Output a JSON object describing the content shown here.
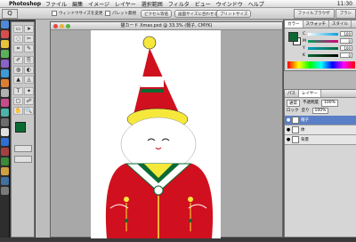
{
  "menubar": {
    "apple": "",
    "app": "Photoshop",
    "items": [
      "ファイル",
      "編集",
      "イメージ",
      "レイヤー",
      "選択範囲",
      "フィルタ",
      "ビュー",
      "ウインドウ",
      "ヘルプ"
    ],
    "clock": "11:30"
  },
  "optionsbar": {
    "tool_icon": "Q",
    "checkbox1": "ウィンドウサイズを変更",
    "checkbox2": "パレット無視",
    "button1": "ピクセル等倍",
    "button2": "画面サイズに合わせる",
    "button3": "プリントサイズ",
    "tab1": "ファイルブラウザ",
    "tab2": "ブラシ"
  },
  "document": {
    "title": "猫カード Xmas.psd @ 33.3% (帽子, CMYK)"
  },
  "colorpanel": {
    "tabs": [
      "カラー",
      "スウォッチ",
      "スタイル"
    ],
    "channels": [
      {
        "label": "C",
        "value": "100"
      },
      {
        "label": "M",
        "value": "0"
      },
      {
        "label": "Y",
        "value": "100"
      },
      {
        "label": "K",
        "value": "0"
      }
    ],
    "fg_color": "#0b6a33"
  },
  "layerspanel": {
    "tabs": [
      "パス",
      "レイヤー"
    ],
    "mode": "通常",
    "opacity_label": "不透明度",
    "opacity": "100%",
    "lock_label": "ロック",
    "fill_label": "塗り",
    "fill": "100%",
    "layers": [
      {
        "name": "帽子",
        "selected": true
      },
      {
        "name": "体",
        "selected": false
      },
      {
        "name": "背景",
        "selected": false
      }
    ]
  },
  "toolbox": {
    "tools": [
      "▭",
      "➤",
      "◌",
      "✂",
      "⌗",
      "✎",
      "✐",
      "⎘",
      "◍",
      "◐",
      "▲",
      "◬",
      "T",
      "✦",
      "▢",
      "☍",
      "✋",
      "🔍"
    ]
  },
  "colors": {
    "red": "#d0101e",
    "green": "#0b6a33",
    "yellow": "#f6e83a"
  }
}
